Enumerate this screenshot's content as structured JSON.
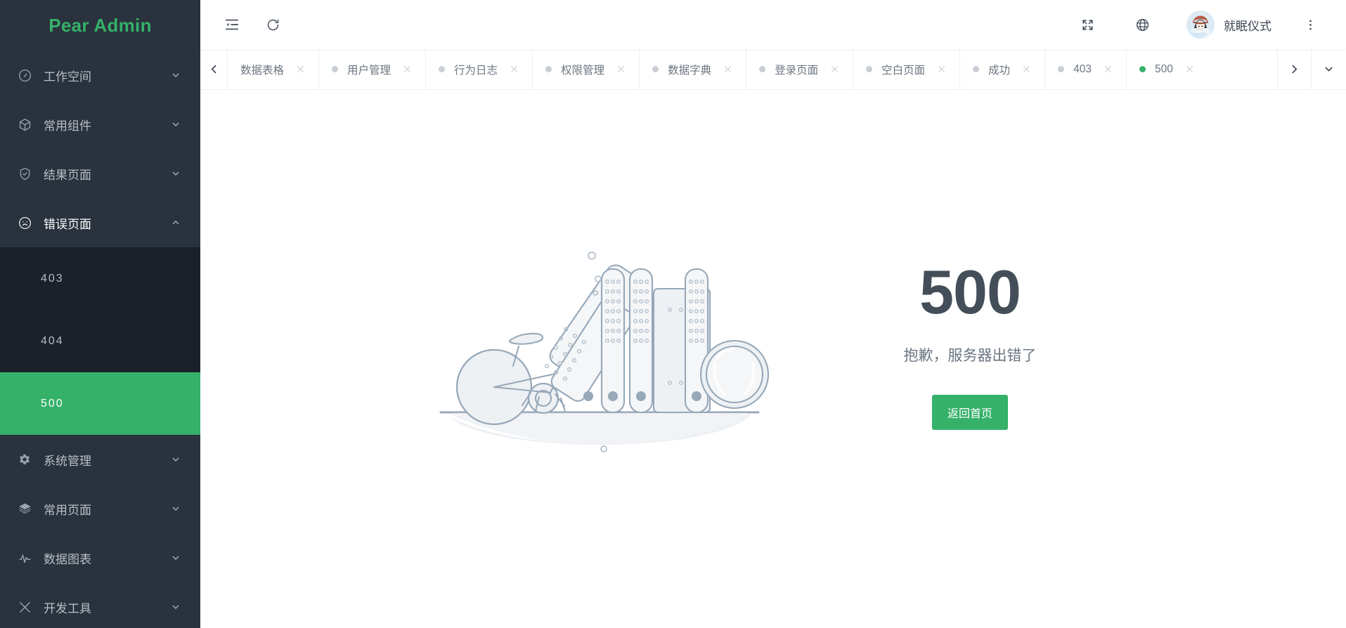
{
  "sidebar": {
    "logo": "Pear Admin",
    "items": [
      {
        "label": "工作空间",
        "icon": "dashboard-icon",
        "expanded": false
      },
      {
        "label": "常用组件",
        "icon": "cube-icon",
        "expanded": false
      },
      {
        "label": "结果页面",
        "icon": "shield-check-icon",
        "expanded": false
      },
      {
        "label": "错误页面",
        "icon": "sad-face-icon",
        "expanded": true
      },
      {
        "label": "系统管理",
        "icon": "gear-icon",
        "expanded": false
      },
      {
        "label": "常用页面",
        "icon": "layers-icon",
        "expanded": false
      },
      {
        "label": "数据图表",
        "icon": "pulse-icon",
        "expanded": false
      },
      {
        "label": "开发工具",
        "icon": "tools-icon",
        "expanded": false
      }
    ],
    "submenu": [
      {
        "label": "403",
        "active": false
      },
      {
        "label": "404",
        "active": false
      },
      {
        "label": "500",
        "active": true
      }
    ]
  },
  "header": {
    "menu_fold_icon": "menu-fold-icon",
    "refresh_icon": "refresh-icon",
    "fullscreen_icon": "fullscreen-icon",
    "language_icon": "globe-icon",
    "more_icon": "more-vertical-icon",
    "user_name": "就眠仪式"
  },
  "tabbar": {
    "scroll_left_icon": "chevron-left-icon",
    "scroll_right_icon": "chevron-right-icon",
    "dropdown_icon": "chevron-down-icon",
    "close_icon": "close-icon",
    "tabs": [
      {
        "label": "数据表格",
        "active": false,
        "show_dot": false
      },
      {
        "label": "用户管理",
        "active": false,
        "show_dot": true
      },
      {
        "label": "行为日志",
        "active": false,
        "show_dot": true
      },
      {
        "label": "权限管理",
        "active": false,
        "show_dot": true
      },
      {
        "label": "数据字典",
        "active": false,
        "show_dot": true
      },
      {
        "label": "登录页面",
        "active": false,
        "show_dot": true
      },
      {
        "label": "空白页面",
        "active": false,
        "show_dot": true
      },
      {
        "label": "成功",
        "active": false,
        "show_dot": true
      },
      {
        "label": "403",
        "active": false,
        "show_dot": true
      },
      {
        "label": "500",
        "active": true,
        "show_dot": true
      }
    ]
  },
  "content": {
    "illustration": "server-crash-illustration",
    "code": "500",
    "description": "抱歉，服务器出错了",
    "button_label": "返回首页"
  },
  "colors": {
    "accent_green": "#35b169",
    "sidebar_bg": "#29323d",
    "submenu_bg": "#1c2129",
    "error_code": "#434e59"
  }
}
